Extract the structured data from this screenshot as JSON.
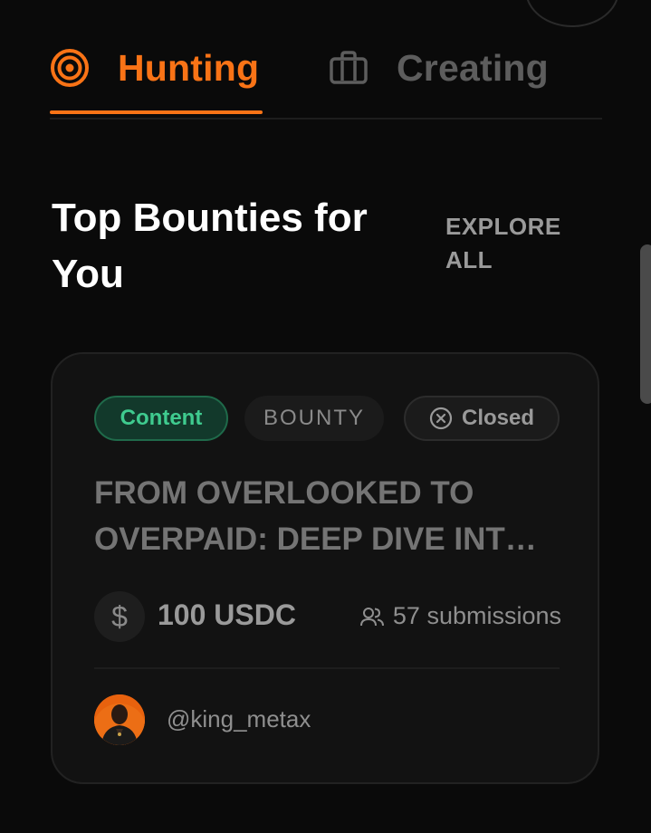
{
  "tabs": [
    {
      "label": "Hunting",
      "icon": "target-icon",
      "active": true
    },
    {
      "label": "Creating",
      "icon": "briefcase-icon",
      "active": false
    }
  ],
  "section": {
    "title": "Top Bounties for You",
    "explore_label": "EXPLORE ALL"
  },
  "card": {
    "category": "Content",
    "type": "BOUNTY",
    "status": "Closed",
    "title": "FROM OVERLOOKED TO OVERPAID: DEEP DIVE INT…",
    "reward": "100 USDC",
    "reward_icon": "$",
    "submissions": "57 submissions",
    "author": "@king_metax"
  },
  "colors": {
    "accent": "#f97316",
    "category_green": "#3fcb8f",
    "background": "#0a0a0a"
  }
}
